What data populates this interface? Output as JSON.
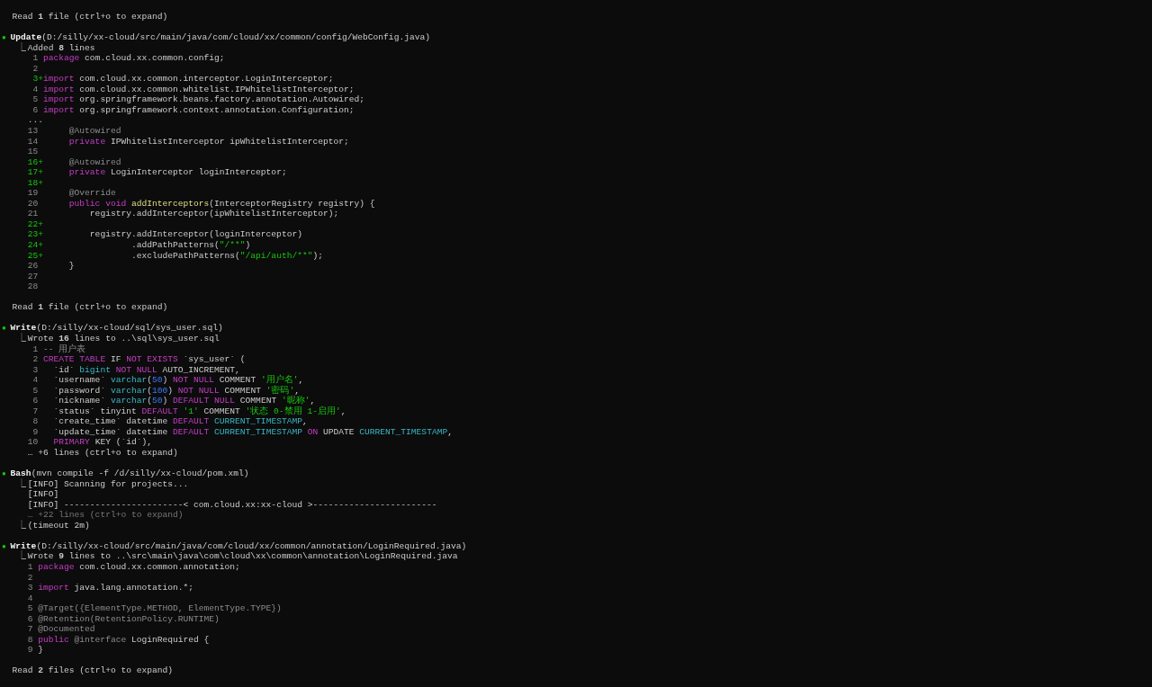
{
  "blocks": [
    {
      "kind": "read",
      "text": "Read **1** file (ctrl+o to expand)"
    },
    {
      "kind": "tool",
      "bullet": "●",
      "name": "Update",
      "args": "(D:/silly/xx-cloud/src/main/java/com/cloud/xx/common/config/WebConfig.java)",
      "lines": [
        {
          "kind": "result",
          "branch": "⎿",
          "text": "Added **8** lines"
        },
        {
          "kind": "code",
          "n": "1",
          "added": false,
          "tokens": [
            {
              "text": "package",
              "kind": "kw"
            },
            {
              "text": " com.cloud.xx.common.config;",
              "kind": "plain"
            }
          ]
        },
        {
          "kind": "code",
          "n": "2",
          "added": false
        },
        {
          "kind": "code",
          "n": "3",
          "added": true,
          "marker": "+",
          "tokens": [
            {
              "text": "import",
              "kind": "kw"
            },
            {
              "text": " com.cloud.xx.common.interceptor.LoginInterceptor;",
              "kind": "plain"
            }
          ]
        },
        {
          "kind": "code",
          "n": "4",
          "added": false,
          "tokens": [
            {
              "text": "import",
              "kind": "kw"
            },
            {
              "text": " com.cloud.xx.common.whitelist.IPWhitelistInterceptor;",
              "kind": "plain"
            }
          ]
        },
        {
          "kind": "code",
          "n": "5",
          "added": false,
          "tokens": [
            {
              "text": "import",
              "kind": "kw"
            },
            {
              "text": " org.springframework.beans.factory.annotation.Autowired;",
              "kind": "plain"
            }
          ]
        },
        {
          "kind": "code",
          "n": "6",
          "added": false,
          "tokens": [
            {
              "text": "import",
              "kind": "kw"
            },
            {
              "text": " org.springframework.context.annotation.Configuration;",
              "kind": "plain"
            }
          ]
        },
        {
          "kind": "output",
          "text": "...",
          "muted": false
        },
        {
          "kind": "code",
          "n": "13",
          "added": false,
          "tokens": [
            {
              "text": "     @Autowired",
              "kind": "ann"
            }
          ]
        },
        {
          "kind": "code",
          "n": "14",
          "added": false,
          "tokens": [
            {
              "text": "     private",
              "kind": "kw"
            },
            {
              "text": " IPWhitelistInterceptor ipWhitelistInterceptor;",
              "kind": "plain"
            }
          ]
        },
        {
          "kind": "code",
          "n": "15",
          "added": false
        },
        {
          "kind": "code",
          "n": "16",
          "added": true,
          "marker": "+",
          "tokens": [
            {
              "text": "     @Autowired",
              "kind": "ann"
            }
          ]
        },
        {
          "kind": "code",
          "n": "17",
          "added": true,
          "marker": "+",
          "tokens": [
            {
              "text": "     private",
              "kind": "kw"
            },
            {
              "text": " LoginInterceptor loginInterceptor;",
              "kind": "plain"
            }
          ]
        },
        {
          "kind": "code",
          "n": "18",
          "added": true,
          "marker": "+"
        },
        {
          "kind": "code",
          "n": "19",
          "added": false,
          "tokens": [
            {
              "text": "     @Override",
              "kind": "ann"
            }
          ]
        },
        {
          "kind": "code",
          "n": "20",
          "added": false,
          "tokens": [
            {
              "text": "     public void",
              "kind": "kw"
            },
            {
              "text": " addInterceptors",
              "kind": "fn"
            },
            {
              "text": "(InterceptorRegistry registry) {",
              "kind": "plain"
            }
          ]
        },
        {
          "kind": "code",
          "n": "21",
          "added": false,
          "tokens": [
            {
              "text": "         registry.addInterceptor(ipWhitelistInterceptor);",
              "kind": "plain"
            }
          ]
        },
        {
          "kind": "code",
          "n": "22",
          "added": true,
          "marker": "+"
        },
        {
          "kind": "code",
          "n": "23",
          "added": true,
          "marker": "+",
          "tokens": [
            {
              "text": "         registry.addInterceptor(loginInterceptor)",
              "kind": "plain"
            }
          ]
        },
        {
          "kind": "code",
          "n": "24",
          "added": true,
          "marker": "+",
          "tokens": [
            {
              "text": "                 .addPathPatterns(",
              "kind": "plain"
            },
            {
              "text": "\"/**\"",
              "kind": "str"
            },
            {
              "text": ")",
              "kind": "plain"
            }
          ]
        },
        {
          "kind": "code",
          "n": "25",
          "added": true,
          "marker": "+",
          "tokens": [
            {
              "text": "                 .excludePathPatterns(",
              "kind": "plain"
            },
            {
              "text": "\"/api/auth/**\"",
              "kind": "str"
            },
            {
              "text": ");",
              "kind": "plain"
            }
          ]
        },
        {
          "kind": "code",
          "n": "26",
          "added": false,
          "tokens": [
            {
              "text": "     }",
              "kind": "plain"
            }
          ]
        },
        {
          "kind": "code",
          "n": "27",
          "added": false
        },
        {
          "kind": "code",
          "n": "28",
          "added": false
        }
      ]
    },
    {
      "kind": "read",
      "text": "Read **1** file (ctrl+o to expand)"
    },
    {
      "kind": "tool",
      "bullet": "●",
      "name": "Write",
      "args": "(D:/silly/xx-cloud/sql/sys_user.sql)",
      "lines": [
        {
          "kind": "result",
          "branch": "⎿",
          "text": "Wrote **16** lines to ..\\sql\\sys_user.sql"
        },
        {
          "kind": "code",
          "n": "1",
          "added": false,
          "tokens": [
            {
              "text": "-- 用户表",
              "kind": "ann"
            }
          ]
        },
        {
          "kind": "code",
          "n": "2",
          "added": false,
          "tokens": [
            {
              "text": "CREATE TABLE",
              "kind": "kw"
            },
            {
              "text": " IF",
              "kind": "plain"
            },
            {
              "text": " NOT EXISTS",
              "kind": "kw"
            },
            {
              "text": " `sys_user` (",
              "kind": "plain"
            }
          ]
        },
        {
          "kind": "code",
          "n": "3",
          "added": false,
          "tokens": [
            {
              "text": "  `id`",
              "kind": "plain"
            },
            {
              "text": " bigint",
              "kind": "type"
            },
            {
              "text": " NOT NULL",
              "kind": "kw"
            },
            {
              "text": " AUTO_INCREMENT,",
              "kind": "plain"
            }
          ]
        },
        {
          "kind": "code",
          "n": "4",
          "added": false,
          "tokens": [
            {
              "text": "  `username`",
              "kind": "plain"
            },
            {
              "text": " varchar",
              "kind": "type"
            },
            {
              "text": "(",
              "kind": "plain"
            },
            {
              "text": "50",
              "kind": "num"
            },
            {
              "text": ")",
              "kind": "plain"
            },
            {
              "text": " NOT NULL",
              "kind": "kw"
            },
            {
              "text": " COMMENT",
              "kind": "plain"
            },
            {
              "text": " '用户名'",
              "kind": "str"
            },
            {
              "text": ",",
              "kind": "plain"
            }
          ]
        },
        {
          "kind": "code",
          "n": "5",
          "added": false,
          "tokens": [
            {
              "text": "  `password`",
              "kind": "plain"
            },
            {
              "text": " varchar",
              "kind": "type"
            },
            {
              "text": "(",
              "kind": "plain"
            },
            {
              "text": "100",
              "kind": "num"
            },
            {
              "text": ")",
              "kind": "plain"
            },
            {
              "text": " NOT NULL",
              "kind": "kw"
            },
            {
              "text": " COMMENT",
              "kind": "plain"
            },
            {
              "text": " '密码'",
              "kind": "str"
            },
            {
              "text": ",",
              "kind": "plain"
            }
          ]
        },
        {
          "kind": "code",
          "n": "6",
          "added": false,
          "tokens": [
            {
              "text": "  `nickname`",
              "kind": "plain"
            },
            {
              "text": " varchar",
              "kind": "type"
            },
            {
              "text": "(",
              "kind": "plain"
            },
            {
              "text": "50",
              "kind": "num"
            },
            {
              "text": ")",
              "kind": "plain"
            },
            {
              "text": " DEFAULT NULL",
              "kind": "kw"
            },
            {
              "text": " COMMENT",
              "kind": "plain"
            },
            {
              "text": " '昵称'",
              "kind": "str"
            },
            {
              "text": ",",
              "kind": "plain"
            }
          ]
        },
        {
          "kind": "code",
          "n": "7",
          "added": false,
          "tokens": [
            {
              "text": "  `status` tinyint",
              "kind": "plain"
            },
            {
              "text": " DEFAULT",
              "kind": "kw"
            },
            {
              "text": " '1'",
              "kind": "str"
            },
            {
              "text": " COMMENT",
              "kind": "plain"
            },
            {
              "text": " '状态 0-禁用 1-启用'",
              "kind": "str"
            },
            {
              "text": ",",
              "kind": "plain"
            }
          ]
        },
        {
          "kind": "code",
          "n": "8",
          "added": false,
          "tokens": [
            {
              "text": "  `create_time` datetime",
              "kind": "plain"
            },
            {
              "text": " DEFAULT",
              "kind": "kw"
            },
            {
              "text": " CURRENT_TIMESTAMP",
              "kind": "type"
            },
            {
              "text": ",",
              "kind": "plain"
            }
          ]
        },
        {
          "kind": "code",
          "n": "9",
          "added": false,
          "tokens": [
            {
              "text": "  `update_time` datetime",
              "kind": "plain"
            },
            {
              "text": " DEFAULT",
              "kind": "kw"
            },
            {
              "text": " CURRENT_TIMESTAMP",
              "kind": "type"
            },
            {
              "text": " ON",
              "kind": "kw"
            },
            {
              "text": " UPDATE",
              "kind": "plain"
            },
            {
              "text": " CURRENT_TIMESTAMP",
              "kind": "type"
            },
            {
              "text": ",",
              "kind": "plain"
            }
          ]
        },
        {
          "kind": "code",
          "n": "10",
          "added": false,
          "tokens": [
            {
              "text": "  PRIMARY",
              "kind": "kw"
            },
            {
              "text": " KEY (`id`),",
              "kind": "plain"
            }
          ]
        },
        {
          "kind": "output",
          "text": "… +6 lines (ctrl+o to expand)",
          "muted": false
        }
      ]
    },
    {
      "kind": "tool",
      "bullet": "●",
      "name": "Bash",
      "args": "(mvn compile -f /d/silly/xx-cloud/pom.xml)",
      "lines": [
        {
          "kind": "result",
          "branch": "⎿",
          "text": "[INFO] Scanning for projects..."
        },
        {
          "kind": "output",
          "text": "[INFO]",
          "muted": false
        },
        {
          "kind": "output",
          "text": "[INFO] -----------------------< com.cloud.xx:xx-cloud >------------------------",
          "muted": false
        },
        {
          "kind": "output",
          "text": "… +22 lines (ctrl+o to expand)",
          "muted": true
        },
        {
          "kind": "result",
          "branch": "⎿",
          "text": "(timeout 2m)"
        }
      ]
    },
    {
      "kind": "tool",
      "bullet": "●",
      "name": "Write",
      "args": "(D:/silly/xx-cloud/src/main/java/com/cloud/xx/common/annotation/LoginRequired.java)",
      "lines": [
        {
          "kind": "result",
          "branch": "⎿",
          "text": "Wrote **9** lines to ..\\src\\main\\java\\com\\cloud\\xx\\common\\annotation\\LoginRequired.java"
        },
        {
          "kind": "code",
          "n": "1",
          "added": false,
          "tokens": [
            {
              "text": "package",
              "kind": "kw"
            },
            {
              "text": " com.cloud.xx.common.annotation;",
              "kind": "plain"
            }
          ]
        },
        {
          "kind": "code",
          "n": "2",
          "added": false
        },
        {
          "kind": "code",
          "n": "3",
          "added": false,
          "tokens": [
            {
              "text": "import",
              "kind": "kw"
            },
            {
              "text": " java.lang.annotation.*;",
              "kind": "plain"
            }
          ]
        },
        {
          "kind": "code",
          "n": "4",
          "added": false
        },
        {
          "kind": "code",
          "n": "5",
          "added": false,
          "tokens": [
            {
              "text": "@Target({ElementType.METHOD, ElementType.TYPE})",
              "kind": "ann"
            }
          ]
        },
        {
          "kind": "code",
          "n": "6",
          "added": false,
          "tokens": [
            {
              "text": "@Retention(RetentionPolicy.RUNTIME)",
              "kind": "ann"
            }
          ]
        },
        {
          "kind": "code",
          "n": "7",
          "added": false,
          "tokens": [
            {
              "text": "@Documented",
              "kind": "ann"
            }
          ]
        },
        {
          "kind": "code",
          "n": "8",
          "added": false,
          "tokens": [
            {
              "text": "public",
              "kind": "kw"
            },
            {
              "text": " @interface",
              "kind": "ann"
            },
            {
              "text": " LoginRequired {",
              "kind": "plain"
            }
          ]
        },
        {
          "kind": "code",
          "n": "9",
          "added": false,
          "tokens": [
            {
              "text": "}",
              "kind": "plain"
            }
          ]
        }
      ]
    },
    {
      "kind": "read",
      "text": "Read **2** files (ctrl+o to expand)"
    }
  ]
}
